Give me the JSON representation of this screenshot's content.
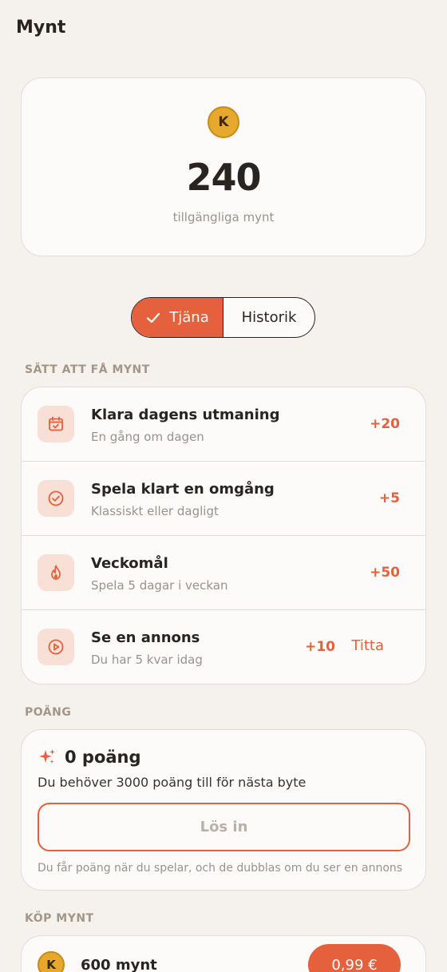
{
  "header": {
    "title": "Mynt"
  },
  "balance": {
    "coin_letter": "K",
    "amount": "240",
    "label": "tillgängliga mynt"
  },
  "tabs": [
    {
      "label": "Tjäna",
      "active": true,
      "icon": "check-icon"
    },
    {
      "label": "Historik",
      "active": false
    }
  ],
  "earn": {
    "heading": "SÄTT ATT FÅ MYNT",
    "items": [
      {
        "icon": "calendar-check-icon",
        "title": "Klara dagens utmaning",
        "subtitle": "En gång om dagen",
        "reward": "+20"
      },
      {
        "icon": "check-circle-icon",
        "title": "Spela klart en omgång",
        "subtitle": "Klassiskt eller dagligt",
        "reward": "+5"
      },
      {
        "icon": "flame-icon",
        "title": "Veckomål",
        "subtitle": "Spela 5 dagar i veckan",
        "reward": "+50"
      },
      {
        "icon": "play-circle-icon",
        "title": "Se en annons",
        "subtitle": "Du har 5 kvar idag",
        "reward": "+10",
        "action": "Titta"
      }
    ]
  },
  "points": {
    "heading": "POÄNG",
    "title": "0 poäng",
    "need_text": "Du behöver 3000 poäng till för nästa byte",
    "redeem_label": "Lös in",
    "note": "Du får poäng när du spelar, och de dubblas om du ser en annons"
  },
  "buy": {
    "heading": "KÖP MYNT",
    "items": [
      {
        "coin_letter": "K",
        "title": "600 mynt",
        "price": "0,99 €"
      }
    ]
  },
  "colors": {
    "accent": "#e5603c",
    "background": "#f5f2ee",
    "card": "#fcfbf9",
    "coin": "#e6a92e"
  }
}
